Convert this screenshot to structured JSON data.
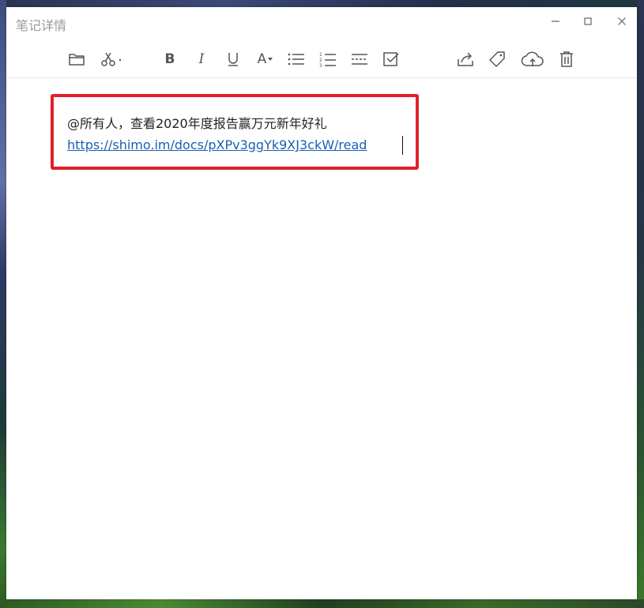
{
  "window": {
    "title": "笔记详情",
    "controls": {
      "minimize": "minimize-icon",
      "maximize": "maximize-icon",
      "close": "close-icon"
    }
  },
  "toolbar": {
    "items": [
      {
        "name": "folder-icon"
      },
      {
        "name": "scissors-icon"
      },
      {
        "name": "bold",
        "label": "B"
      },
      {
        "name": "italic",
        "label": "I"
      },
      {
        "name": "underline-icon"
      },
      {
        "name": "font-color",
        "label": "A"
      },
      {
        "name": "bulleted-list-icon"
      },
      {
        "name": "numbered-list-icon"
      },
      {
        "name": "divider-line-icon"
      },
      {
        "name": "checkbox-icon"
      },
      {
        "name": "share-icon"
      },
      {
        "name": "tag-icon"
      },
      {
        "name": "cloud-upload-icon"
      },
      {
        "name": "trash-icon"
      }
    ]
  },
  "note": {
    "line1": "@所有人，查看2020年度报告赢万元新年好礼",
    "link": "https://shimo.im/docs/pXPv3ggYk9XJ3ckW/read"
  },
  "colors": {
    "highlight_border": "#e0202a",
    "link": "#1a5fb4",
    "title_text": "#9a9a9a"
  }
}
